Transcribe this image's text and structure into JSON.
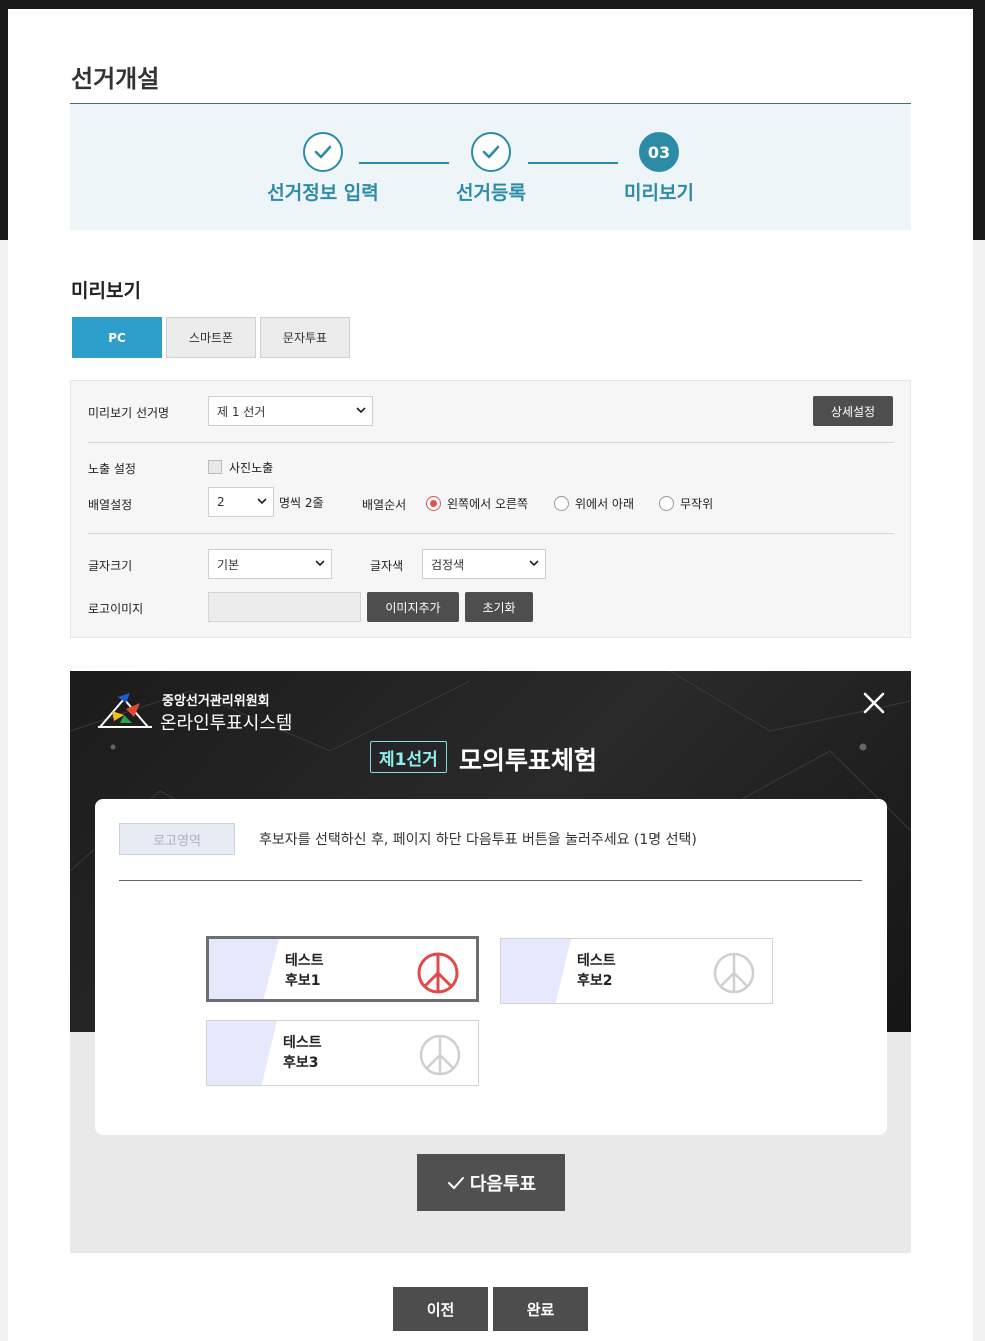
{
  "page": {
    "title": "선거개설"
  },
  "stepper": {
    "steps": [
      {
        "label": "선거정보 입력",
        "state": "done"
      },
      {
        "label": "선거등록",
        "state": "done"
      },
      {
        "label": "미리보기",
        "state": "active",
        "number": "03"
      }
    ]
  },
  "preview_section": {
    "title": "미리보기",
    "tabs": [
      {
        "label": "PC",
        "active": true
      },
      {
        "label": "스마트폰",
        "active": false
      },
      {
        "label": "문자투표",
        "active": false
      }
    ]
  },
  "settings": {
    "election_name_label": "미리보기 선거명",
    "election_name_value": "제 1 선거",
    "detail_button": "상세설정",
    "exposure_label": "노출 설정",
    "photo_checkbox_label": "사진노출",
    "photo_checked": false,
    "layout_label": "배열설정",
    "layout_value": "2",
    "layout_suffix": "명씩 2줄",
    "order_label": "배열순서",
    "order_options": [
      {
        "label": "왼쪽에서 오른쪽",
        "selected": true
      },
      {
        "label": "위에서 아래",
        "selected": false
      },
      {
        "label": "무작위",
        "selected": false
      }
    ],
    "font_size_label": "글자크기",
    "font_size_value": "기본",
    "font_color_label": "글자색",
    "font_color_value": "검정색",
    "logo_label": "로고이미지",
    "add_image_button": "이미지추가",
    "reset_button": "초기화"
  },
  "ballot_preview": {
    "org_sub": "중앙선거관리위원회",
    "org_main": "온라인투표시스템",
    "election_badge": "제1선거",
    "title": "모의투표체험",
    "logo_area": "로고영역",
    "instruction": "후보자를 선택하신 후, 페이지 하단 다음투표 버튼을 눌러주세요 (1명 선택)",
    "candidates": [
      {
        "line1": "테스트",
        "line2": "후보1",
        "selected": true
      },
      {
        "line1": "테스트",
        "line2": "후보2",
        "selected": false
      },
      {
        "line1": "테스트",
        "line2": "후보3",
        "selected": false
      }
    ],
    "next_button": "다음투표"
  },
  "footer": {
    "prev_button": "이전",
    "done_button": "완료"
  },
  "colors": {
    "accent": "#2e8ba8",
    "tab_active": "#2e9fca",
    "stamp_red": "#e04a4a",
    "dark_button": "#4e4e4e"
  }
}
